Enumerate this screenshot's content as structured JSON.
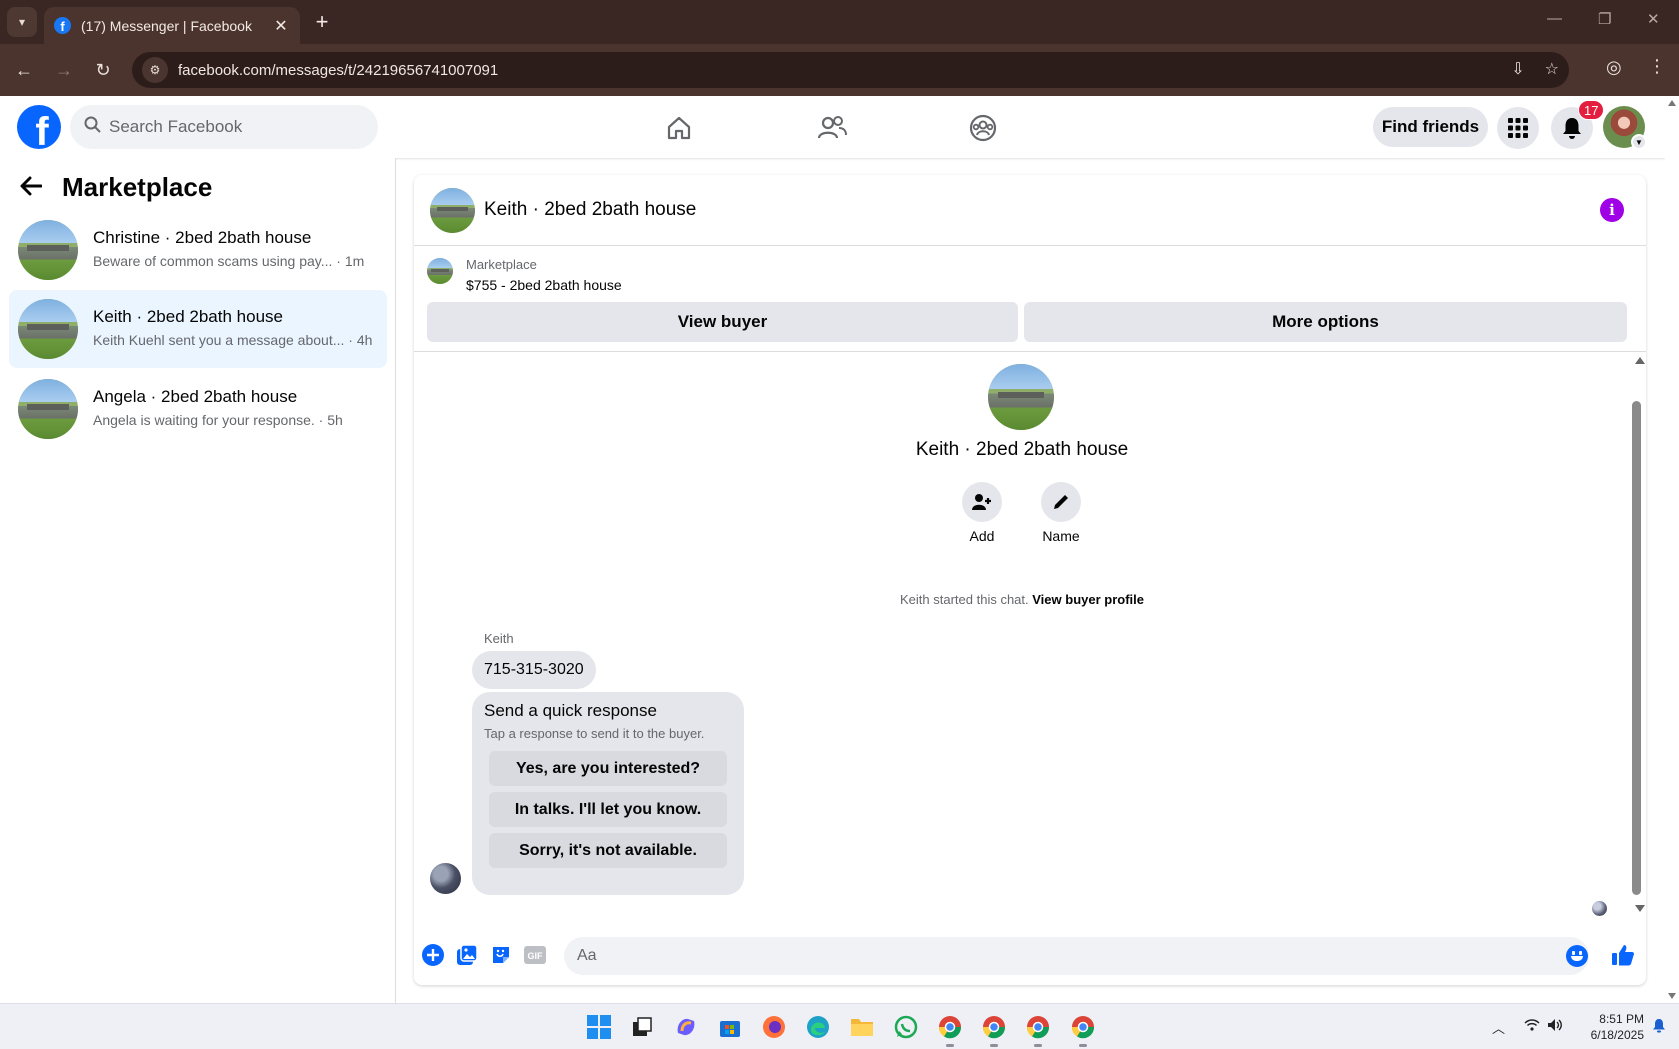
{
  "browser": {
    "tab_title": "(17) Messenger | Facebook",
    "url": "facebook.com/messages/t/24219656741007091",
    "new_tab_symbol": "+",
    "close_symbol": "✕"
  },
  "header": {
    "logo_letter": "f",
    "search_placeholder": "Search Facebook",
    "find_friends_label": "Find friends",
    "notification_count": "17",
    "nav_icons": [
      "home-icon",
      "friends-icon",
      "groups-icon"
    ]
  },
  "sidebar": {
    "title": "Marketplace",
    "conversations": [
      {
        "name": "Christine · 2bed 2bath house",
        "preview": "Beware of common scams using pay...",
        "time": " · 1m",
        "active": false
      },
      {
        "name": "Keith · 2bed 2bath house",
        "preview": "Keith Kuehl sent you a message about...",
        "time": " · 4h",
        "active": true
      },
      {
        "name": "Angela · 2bed 2bath house",
        "preview": "Angela is waiting for your response.",
        "time": " · 5h",
        "active": false
      }
    ]
  },
  "chat": {
    "title": "Keith · 2bed 2bath house",
    "listing_source": "Marketplace",
    "listing_price_title": "$755 - 2bed 2bath house",
    "view_buyer_label": "View buyer",
    "more_options_label": "More options",
    "profile_name": "Keith · 2bed 2bath house",
    "actions": [
      {
        "label": "Add",
        "icon": "add-person-icon"
      },
      {
        "label": "Name",
        "icon": "pencil-icon"
      }
    ],
    "started_text": "Keith started this chat.",
    "view_buyer_profile_label": "View buyer profile",
    "sender_name": "Keith",
    "phone_message": "715-315-3020",
    "quick_response": {
      "title": "Send a quick response",
      "subtitle": "Tap a response to send it to the buyer.",
      "options": [
        "Yes, are you interested?",
        "In talks. I'll let you know.",
        "Sorry, it's not available."
      ]
    },
    "composer_placeholder": "Aa",
    "accent_color": "#0866ff",
    "info_color": "#a000e6"
  },
  "taskbar": {
    "time": "8:51 PM",
    "date": "6/18/2025"
  }
}
